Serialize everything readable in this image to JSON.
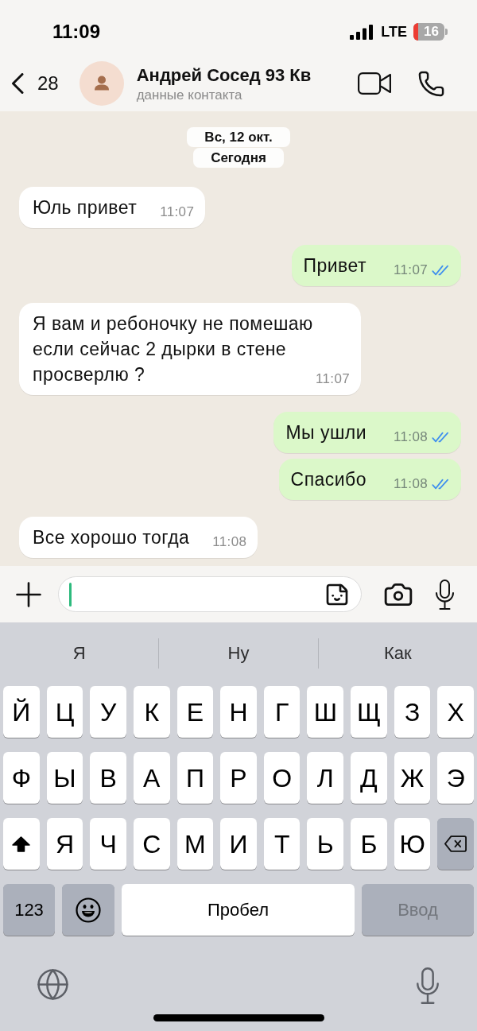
{
  "status_bar": {
    "time": "11:09",
    "network": "LTE",
    "battery": "16"
  },
  "header": {
    "back_count": "28",
    "contact_name": "Андрей Сосед 93 Кв",
    "subtitle": "данные контакта"
  },
  "date_labels": [
    "Вс, 12 окт.",
    "Сегодня"
  ],
  "messages": [
    {
      "kind": "incoming",
      "text": "Юль привет",
      "time": "11:07"
    },
    {
      "kind": "outgoing",
      "text": "Привет",
      "time": "11:07",
      "read": true
    },
    {
      "kind": "incoming",
      "text": "Я вам и ребоночку не помешаю если сейчас 2 дырки в стене просверлю ?",
      "time": "11:07"
    },
    {
      "kind": "outgoing",
      "text": "Мы ушли",
      "time": "11:08",
      "read": true
    },
    {
      "kind": "outgoing",
      "text": "Спасибо",
      "time": "11:08",
      "read": true
    },
    {
      "kind": "incoming",
      "text": "Все хорошо тогда",
      "time": "11:08"
    }
  ],
  "composer": {
    "focused": true
  },
  "keyboard": {
    "suggestions": [
      "Я",
      "Ну",
      "Как"
    ],
    "rows": [
      [
        {
          "kind": "letter",
          "label": "Й"
        },
        {
          "kind": "letter",
          "label": "Ц"
        },
        {
          "kind": "letter",
          "label": "У"
        },
        {
          "kind": "letter",
          "label": "К"
        },
        {
          "kind": "letter",
          "label": "Е"
        },
        {
          "kind": "letter",
          "label": "Н"
        },
        {
          "kind": "letter",
          "label": "Г"
        },
        {
          "kind": "letter",
          "label": "Ш"
        },
        {
          "kind": "letter",
          "label": "Щ"
        },
        {
          "kind": "letter",
          "label": "З"
        },
        {
          "kind": "letter",
          "label": "Х"
        }
      ],
      [
        {
          "kind": "letter",
          "label": "Ф"
        },
        {
          "kind": "letter",
          "label": "Ы"
        },
        {
          "kind": "letter",
          "label": "В"
        },
        {
          "kind": "letter",
          "label": "А"
        },
        {
          "kind": "letter",
          "label": "П"
        },
        {
          "kind": "letter",
          "label": "Р"
        },
        {
          "kind": "letter",
          "label": "О"
        },
        {
          "kind": "letter",
          "label": "Л"
        },
        {
          "kind": "letter",
          "label": "Д"
        },
        {
          "kind": "letter",
          "label": "Ж"
        },
        {
          "kind": "letter",
          "label": "Э"
        }
      ],
      [
        {
          "kind": "shift",
          "on": true
        },
        {
          "kind": "letter",
          "label": "Я"
        },
        {
          "kind": "letter",
          "label": "Ч"
        },
        {
          "kind": "letter",
          "label": "С"
        },
        {
          "kind": "letter",
          "label": "М"
        },
        {
          "kind": "letter",
          "label": "И"
        },
        {
          "kind": "letter",
          "label": "Т"
        },
        {
          "kind": "letter",
          "label": "Ь"
        },
        {
          "kind": "letter",
          "label": "Б"
        },
        {
          "kind": "letter",
          "label": "Ю"
        },
        {
          "kind": "backspace"
        }
      ]
    ],
    "bottom_row": {
      "numbers_key": "123",
      "space_key": "Пробел",
      "return_key": {
        "label": "Ввод",
        "disabled": true
      }
    }
  }
}
